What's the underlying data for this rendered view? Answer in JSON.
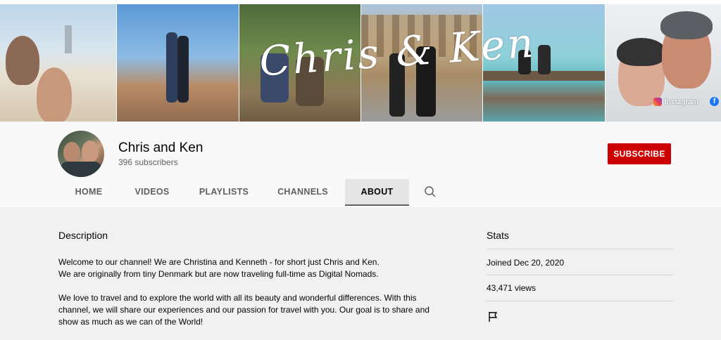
{
  "banner": {
    "script_title": "Chris & Ken",
    "instagram_label": "Instagram",
    "facebook_glyph": "f"
  },
  "channel": {
    "name": "Chris and Ken",
    "subscribers": "396 subscribers",
    "subscribe_label": "SUBSCRIBE",
    "subscribe_color": "#cc0000"
  },
  "tabs": [
    {
      "label": "HOME"
    },
    {
      "label": "VIDEOS"
    },
    {
      "label": "PLAYLISTS"
    },
    {
      "label": "CHANNELS"
    },
    {
      "label": "ABOUT"
    }
  ],
  "about": {
    "description_heading": "Description",
    "description_lines": [
      "Welcome to our channel! We are Christina and Kenneth - for short just Chris and Ken.",
      "We are originally from tiny Denmark but are now traveling full-time as Digital Nomads.",
      "We love to travel and to explore the world with all its beauty and wonderful differences. With this channel, we will share our experiences and our passion for travel with you. Our goal is to share and show as much as we can of the World!"
    ],
    "stats_heading": "Stats",
    "joined": "Joined Dec 20, 2020",
    "views": "43,471 views"
  },
  "icons": {
    "search": "search-icon",
    "flag": "flag-icon",
    "instagram": "instagram-icon",
    "facebook": "facebook-icon"
  }
}
